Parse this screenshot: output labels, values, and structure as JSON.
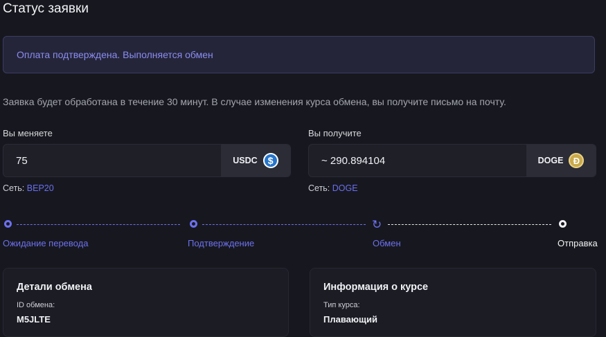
{
  "page": {
    "title": "Статус заявки",
    "alert": "Оплата подтверждена. Выполняется обмен",
    "note": "Заявка будет обработана в течение 30 минут. В случае изменения курса обмена, вы получите письмо на почту."
  },
  "send": {
    "label": "Вы меняете",
    "amount": "75",
    "currency": "USDC",
    "currency_icon": "usdc-coin-icon",
    "network_label": "Сеть:",
    "network": "BEP20"
  },
  "receive": {
    "label": "Вы получите",
    "amount": "~ 290.894104",
    "currency": "DOGE",
    "currency_icon": "doge-coin-icon",
    "network_label": "Сеть:",
    "network": "DOGE"
  },
  "steps": [
    {
      "label": "Ожидание перевода",
      "state": "done"
    },
    {
      "label": "Подтверждение",
      "state": "done"
    },
    {
      "label": "Обмен",
      "state": "active"
    },
    {
      "label": "Отправка",
      "state": "pending"
    }
  ],
  "cards": {
    "details": {
      "title": "Детали обмена",
      "field_label": "ID обмена:",
      "field_value": "M5JLTE"
    },
    "rate": {
      "title": "Информация о курсе",
      "field_label": "Тип курса:",
      "field_value": "Плавающий"
    }
  },
  "colors": {
    "accent": "#6d70ee",
    "background": "#17181f",
    "panel": "#1e1f27"
  }
}
